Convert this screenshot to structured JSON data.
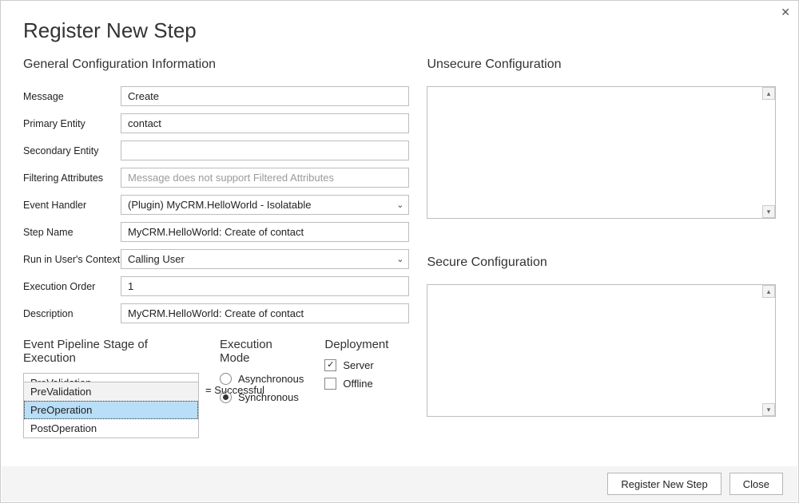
{
  "window": {
    "title": "Register New Step",
    "close_glyph": "✕"
  },
  "general": {
    "heading": "General Configuration Information",
    "labels": {
      "message": "Message",
      "primary_entity": "Primary Entity",
      "secondary_entity": "Secondary Entity",
      "filtering_attributes": "Filtering Attributes",
      "event_handler": "Event Handler",
      "step_name": "Step Name",
      "run_in_context": "Run in User's Context",
      "execution_order": "Execution Order",
      "description": "Description"
    },
    "values": {
      "message": "Create",
      "primary_entity": "contact",
      "secondary_entity": "",
      "filtering_attributes_placeholder": "Message does not support Filtered Attributes",
      "event_handler": "(Plugin) MyCRM.HelloWorld - Isolatable",
      "step_name": "MyCRM.HelloWorld: Create of contact",
      "run_in_context": "Calling User",
      "execution_order": "1",
      "description": "MyCRM.HelloWorld: Create of contact"
    }
  },
  "pipeline": {
    "heading": "Event Pipeline Stage of Execution",
    "selected": "PreValidation",
    "options": [
      "PreValidation",
      "PreOperation",
      "PostOperation"
    ],
    "highlighted_index": 1
  },
  "execution_mode": {
    "heading": "Execution Mode",
    "options": {
      "async": "Asynchronous",
      "sync": "Synchronous"
    },
    "selected": "sync"
  },
  "deployment": {
    "heading": "Deployment",
    "options": {
      "server": "Server",
      "offline": "Offline"
    },
    "checked": {
      "server": true,
      "offline": false
    }
  },
  "delete_status": {
    "text_fragment": "= Successful"
  },
  "right": {
    "unsecure_heading": "Unsecure  Configuration",
    "secure_heading": "Secure  Configuration"
  },
  "footer": {
    "register": "Register New Step",
    "close": "Close"
  },
  "glyphs": {
    "chevron_down": "⌄",
    "check": "✓",
    "tri_up": "▴",
    "tri_down": "▾"
  }
}
